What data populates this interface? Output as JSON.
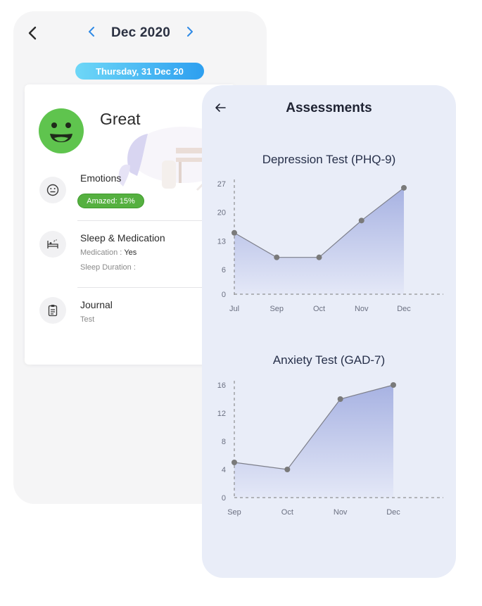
{
  "journal": {
    "month": "Dec 2020",
    "date_pill": "Thursday, 31 Dec 20",
    "mood": "Great",
    "emotions": {
      "title": "Emotions",
      "chip": "Amazed: 15%"
    },
    "sleep": {
      "title": "Sleep & Medication",
      "medication_label": "Medication :",
      "medication_value": "Yes",
      "duration_label": "Sleep Duration :"
    },
    "notes": {
      "title": "Journal",
      "text": "Test"
    },
    "icons": [
      "chevron-left-icon",
      "chevron-right-icon",
      "neutral-face-icon",
      "bed-icon",
      "clipboard-icon"
    ]
  },
  "assessments": {
    "title": "Assessments",
    "back_icon": "arrow-left-icon"
  },
  "colors": {
    "accent_blue": "#2f8ae6",
    "mood_green": "#5fc44e",
    "chart_fill_top": "#a7b2e2",
    "chart_point": "#7a7a7a",
    "panel_bg": "#e9edf8"
  },
  "chart_data": [
    {
      "type": "area",
      "title": "Depression Test (PHQ-9)",
      "categories": [
        "Jul",
        "Sep",
        "Oct",
        "Nov",
        "Dec"
      ],
      "values": [
        15,
        9,
        9,
        18,
        26
      ],
      "yticks": [
        0,
        6,
        13,
        20,
        27
      ],
      "ylim": [
        0,
        27
      ],
      "xlabel": "",
      "ylabel": ""
    },
    {
      "type": "area",
      "title": "Anxiety Test (GAD-7)",
      "categories": [
        "Sep",
        "Oct",
        "Nov",
        "Dec"
      ],
      "values": [
        5,
        4,
        14,
        16
      ],
      "yticks": [
        0,
        4,
        8,
        12,
        16
      ],
      "ylim": [
        0,
        16
      ],
      "xlabel": "",
      "ylabel": ""
    }
  ]
}
